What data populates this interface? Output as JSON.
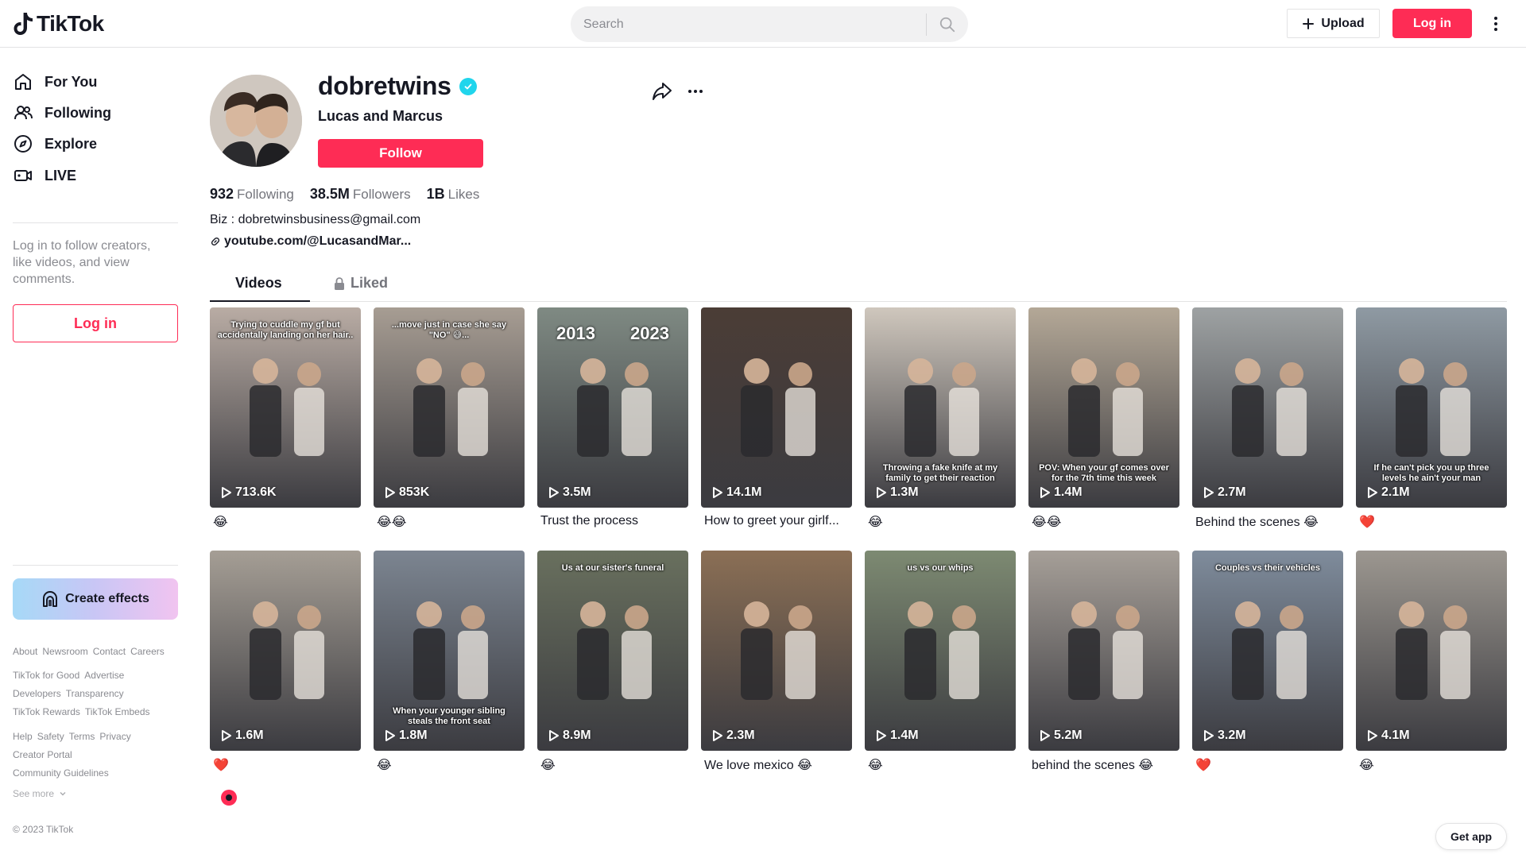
{
  "header": {
    "logo_text": "TikTok",
    "search_placeholder": "Search",
    "upload_label": "Upload",
    "login_label": "Log in"
  },
  "sidebar": {
    "nav": [
      {
        "label": "For You",
        "icon": "home-icon"
      },
      {
        "label": "Following",
        "icon": "users-icon"
      },
      {
        "label": "Explore",
        "icon": "compass-icon"
      },
      {
        "label": "LIVE",
        "icon": "live-camera-icon"
      }
    ],
    "login_prompt": "Log in to follow creators, like videos, and view comments.",
    "login_label": "Log in",
    "create_effects_label": "Create effects",
    "footer_rows": [
      [
        "About",
        "Newsroom",
        "Contact",
        "Careers"
      ],
      [
        "TikTok for Good",
        "Advertise"
      ],
      [
        "Developers",
        "Transparency"
      ],
      [
        "TikTok Rewards",
        "TikTok Embeds"
      ],
      [
        "Help",
        "Safety",
        "Terms",
        "Privacy"
      ],
      [
        "Creator Portal"
      ],
      [
        "Community Guidelines"
      ]
    ],
    "see_more": "See more",
    "copyright": "© 2023 TikTok"
  },
  "profile": {
    "username": "dobretwins",
    "display_name": "Lucas and Marcus",
    "follow_label": "Follow",
    "following_count": "932",
    "following_label": "Following",
    "followers_count": "38.5M",
    "followers_label": "Followers",
    "likes_count": "1B",
    "likes_label": "Likes",
    "bio": "Biz : dobretwinsbusiness@gmail.com",
    "link": "youtube.com/@LucasandMar..."
  },
  "tabs": {
    "videos": "Videos",
    "liked": "Liked"
  },
  "videos": [
    {
      "views": "713.6K",
      "desc": "😂",
      "caption": "Trying to cuddle my gf but accidentally landing on her hair..",
      "bg": "#b9aca4"
    },
    {
      "views": "853K",
      "desc": "😂😂",
      "caption": "...move just in case she say \"NO\" 😅...",
      "bg": "#a79d93"
    },
    {
      "views": "3.5M",
      "desc": "Trust the process",
      "caption": "",
      "year_left": "2013",
      "year_right": "2023",
      "bg": "#7f8a83"
    },
    {
      "views": "14.1M",
      "desc": "How to greet your girlf...",
      "caption": "",
      "bg": "#4b3d36"
    },
    {
      "views": "1.3M",
      "desc": "😂",
      "caption": "Throwing a fake knife at my family to get their reaction",
      "bg": "#cfc7bd"
    },
    {
      "views": "1.4M",
      "desc": "😂😂",
      "caption": "POV: When your gf comes over for the 7th time this week",
      "bg": "#b4a897"
    },
    {
      "views": "2.7M",
      "desc": "Behind the scenes 😂",
      "caption": "",
      "bg": "#9ea2a3"
    },
    {
      "views": "2.1M",
      "desc": "❤️",
      "caption": "If he can't pick you up three levels he ain't your man",
      "bg": "#8f9aa3"
    },
    {
      "views": "1.6M",
      "desc": "❤️",
      "caption": "",
      "bg": "#a59e95"
    },
    {
      "views": "1.8M",
      "desc": "😂",
      "caption": "When your younger sibling steals the front seat",
      "bg": "#7c8591"
    },
    {
      "views": "8.9M",
      "desc": "😂",
      "caption": "Us at our sister's funeral",
      "bg": "#69705e"
    },
    {
      "views": "2.3M",
      "desc": "We love mexico 😂",
      "caption": "",
      "bg": "#8b6f55"
    },
    {
      "views": "1.4M",
      "desc": "😂",
      "caption": "us vs our whips",
      "bg": "#7d8a72"
    },
    {
      "views": "5.2M",
      "desc": "behind the scenes 😂",
      "caption": "",
      "bg": "#a69f98"
    },
    {
      "views": "3.2M",
      "desc": "❤️",
      "caption": "Couples vs their vehicles",
      "bg": "#7f8c9c"
    },
    {
      "views": "4.1M",
      "desc": "😂",
      "caption": "",
      "bg": "#9c9790"
    }
  ],
  "get_app_label": "Get app",
  "colors": {
    "brand": "#fe2c55",
    "verified": "#20d5ec"
  }
}
